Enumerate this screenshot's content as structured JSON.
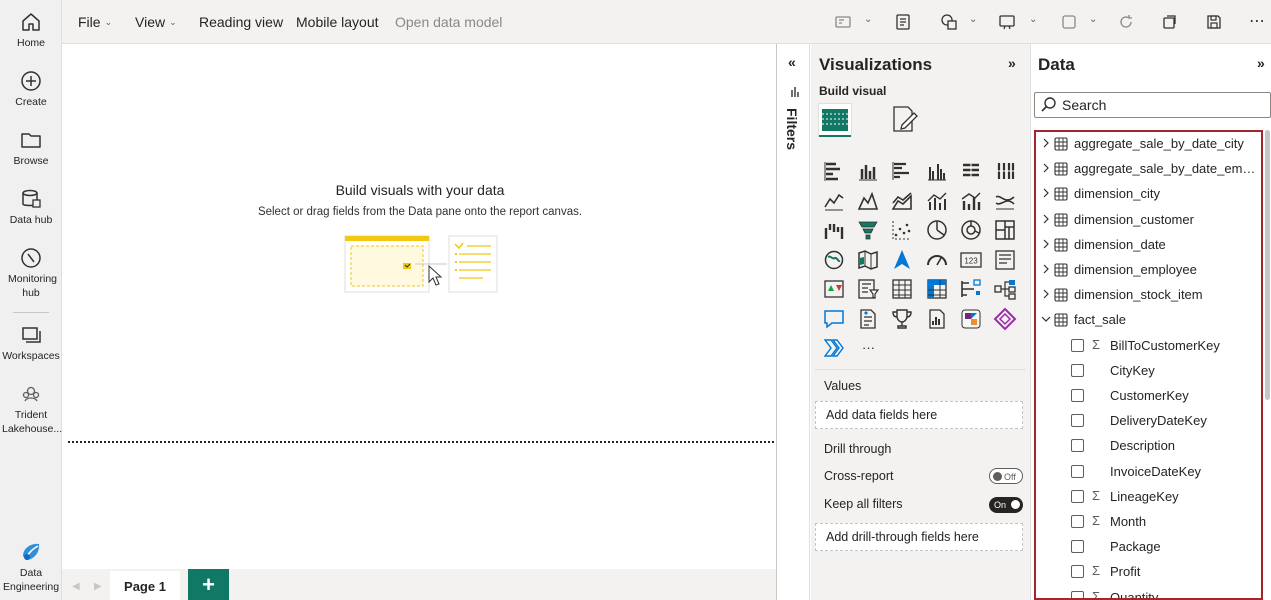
{
  "rail": {
    "items": [
      {
        "label": "Home",
        "icon": "home-icon"
      },
      {
        "label": "Create",
        "icon": "create-icon"
      },
      {
        "label": "Browse",
        "icon": "browse-icon"
      },
      {
        "label": "Data hub",
        "icon": "data-hub-icon"
      },
      {
        "label": "Monitoring hub",
        "icon": "monitoring-hub-icon"
      },
      {
        "label": "Workspaces",
        "icon": "workspaces-icon"
      },
      {
        "label": "Trident Lakehouse...",
        "icon": "lakehouse-icon"
      },
      {
        "label": "Data Engineering",
        "icon": "data-engineering-icon"
      }
    ]
  },
  "menu": {
    "file": "File",
    "view": "View",
    "reading_view": "Reading view",
    "mobile_layout": "Mobile layout",
    "open_data_model": "Open data model"
  },
  "canvas": {
    "empty_title": "Build visuals with your data",
    "empty_subtitle": "Select or drag fields from the Data pane onto the report canvas."
  },
  "pages": {
    "tabs": [
      "Page 1"
    ],
    "add_label": "+"
  },
  "filters": {
    "label": "Filters"
  },
  "visualizations": {
    "title": "Visualizations",
    "build_visual": "Build visual",
    "more_label": "···",
    "values_label": "Values",
    "values_placeholder": "Add data fields here",
    "drill_through_label": "Drill through",
    "cross_report_label": "Cross-report",
    "cross_report_state": "Off",
    "keep_all_filters_label": "Keep all filters",
    "keep_all_filters_state": "On",
    "drill_through_placeholder": "Add drill-through fields here"
  },
  "data_pane": {
    "title": "Data",
    "search_placeholder": "Search",
    "tables": [
      "aggregate_sale_by_date_city",
      "aggregate_sale_by_date_employee",
      "dimension_city",
      "dimension_customer",
      "dimension_date",
      "dimension_employee",
      "dimension_stock_item",
      "fact_sale"
    ],
    "fields": [
      {
        "name": "BillToCustomerKey",
        "sigma": true
      },
      {
        "name": "CityKey",
        "sigma": false
      },
      {
        "name": "CustomerKey",
        "sigma": false
      },
      {
        "name": "DeliveryDateKey",
        "sigma": false
      },
      {
        "name": "Description",
        "sigma": false
      },
      {
        "name": "InvoiceDateKey",
        "sigma": false
      },
      {
        "name": "LineageKey",
        "sigma": true
      },
      {
        "name": "Month",
        "sigma": true
      },
      {
        "name": "Package",
        "sigma": false
      },
      {
        "name": "Profit",
        "sigma": true
      },
      {
        "name": "Quantity",
        "sigma": true
      }
    ],
    "sigma_symbol": "Σ"
  },
  "colors": {
    "accent": "#117865",
    "highlight_border": "#a4262c"
  }
}
